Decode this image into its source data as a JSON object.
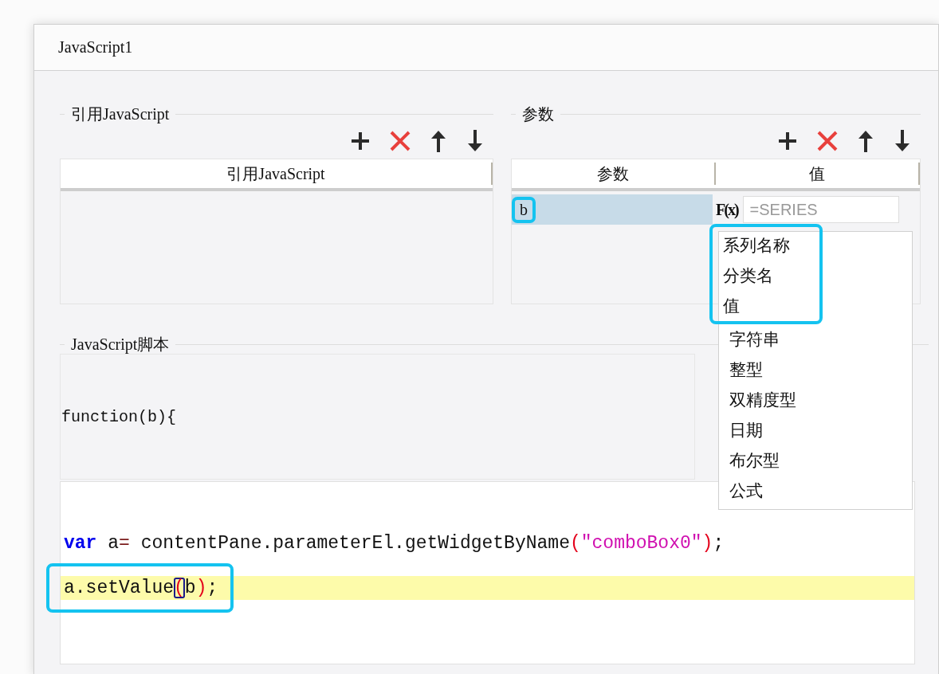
{
  "window": {
    "title": "JavaScript1"
  },
  "reference_section": {
    "title": "引用JavaScript",
    "table": {
      "columns": [
        "引用JavaScript"
      ]
    }
  },
  "parameters_section": {
    "title": "参数",
    "table": {
      "columns": [
        "参数",
        "值"
      ],
      "rows": [
        {
          "name": "b",
          "selected": true,
          "highlighted": true,
          "value": {
            "formula_label": "F(x)",
            "placeholder": "=SERIES"
          }
        }
      ]
    }
  },
  "type_dropdown": {
    "options": [
      {
        "label": "系列名称",
        "highlighted": true
      },
      {
        "label": "分类名",
        "highlighted": true
      },
      {
        "label": "值",
        "highlighted": true
      },
      {
        "label": "字符串",
        "highlighted": false
      },
      {
        "label": "整型",
        "highlighted": false
      },
      {
        "label": "双精度型",
        "highlighted": false
      },
      {
        "label": "日期",
        "highlighted": false
      },
      {
        "label": "布尔型",
        "highlighted": false
      },
      {
        "label": "公式",
        "highlighted": false
      }
    ]
  },
  "script_section": {
    "title": "JavaScript脚本",
    "signature": "function(b){",
    "code_lines": [
      {
        "current": false,
        "highlighted": false,
        "tokens": [
          {
            "kind": "keyword",
            "text": "var"
          },
          {
            "kind": "plain",
            "text": " a"
          },
          {
            "kind": "operator",
            "text": "="
          },
          {
            "kind": "plain",
            "text": " contentPane.parameterEl.getWidgetByName"
          },
          {
            "kind": "paren",
            "text": "("
          },
          {
            "kind": "string",
            "text": "\"comboBox0\""
          },
          {
            "kind": "paren",
            "text": ")"
          },
          {
            "kind": "plain",
            "text": ";"
          }
        ]
      },
      {
        "current": true,
        "highlighted": true,
        "tokens": [
          {
            "kind": "plain",
            "text": "a.setValue"
          },
          {
            "kind": "matched-paren",
            "text": "("
          },
          {
            "kind": "plain",
            "text": "b"
          },
          {
            "kind": "paren",
            "text": ")"
          },
          {
            "kind": "plain",
            "text": ";"
          }
        ]
      }
    ]
  }
}
